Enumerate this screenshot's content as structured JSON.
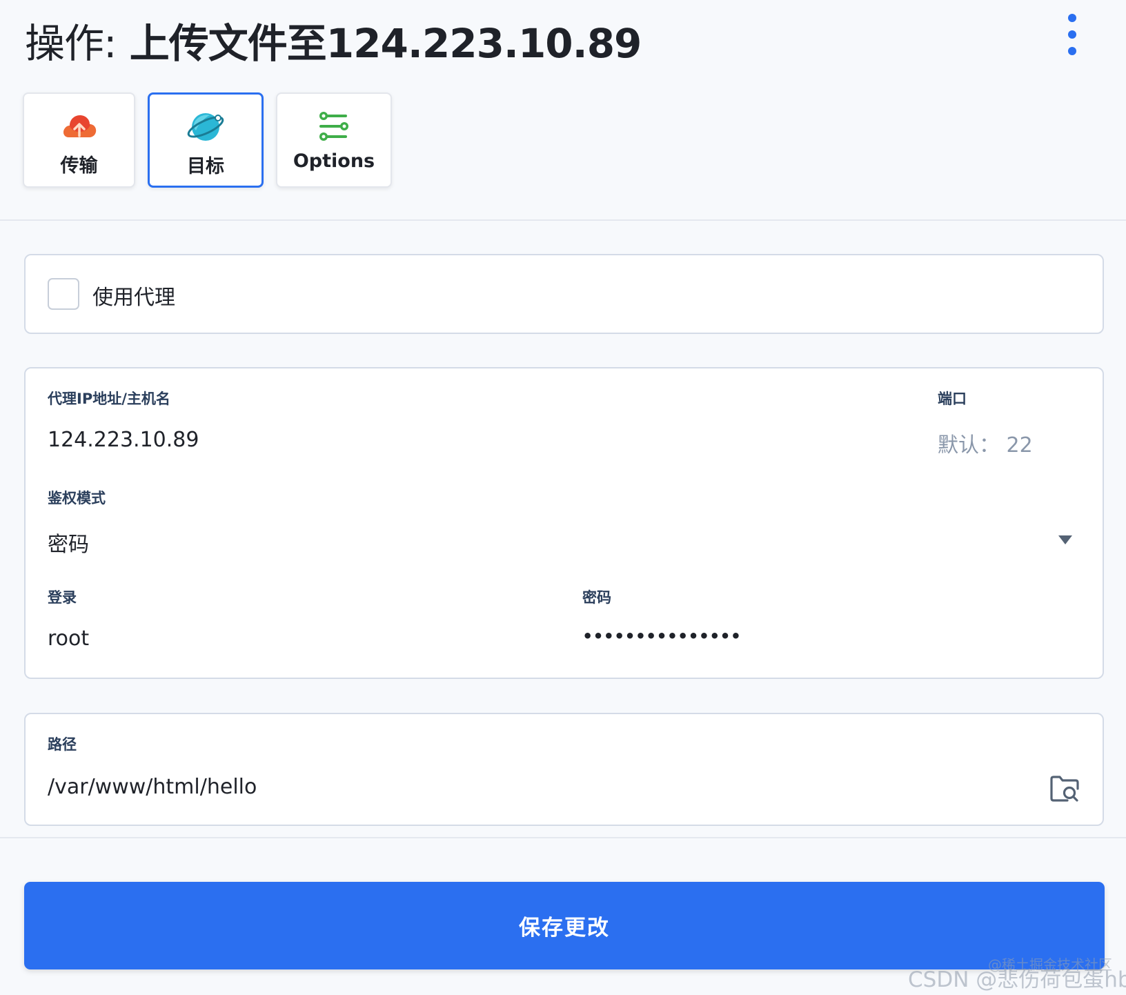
{
  "header": {
    "title_prefix": "操作:",
    "title_main": "上传文件至124.223.10.89",
    "more_icon": "more-vertical-icon"
  },
  "tabs": [
    {
      "label": "传输",
      "icon": "cloud-upload-icon",
      "active": false
    },
    {
      "label": "目标",
      "icon": "planet-icon",
      "active": true
    },
    {
      "label": "Options",
      "icon": "sliders-icon",
      "active": false
    }
  ],
  "proxy_toggle": {
    "label": "使用代理",
    "checked": false
  },
  "connection": {
    "host_label": "代理IP地址/主机名",
    "host_value": "124.223.10.89",
    "port_label": "端口",
    "port_placeholder": "默认： 22",
    "auth_label": "鉴权模式",
    "auth_value": "密码",
    "login_label": "登录",
    "login_value": "root",
    "password_label": "密码",
    "password_value": "•••••••••••••••"
  },
  "path": {
    "label": "路径",
    "value": "/var/www/html/hello",
    "browse_icon": "folder-search-icon"
  },
  "footer": {
    "save_label": "保存更改"
  },
  "watermark": {
    "small": "@稀土掘金技术社区",
    "main": "CSDN @悲伤荷包蛋hb"
  },
  "colors": {
    "accent": "#2b6ff0",
    "background": "#f7f9fc",
    "label_text": "#2b3f5c",
    "border": "#d4dbe7"
  }
}
